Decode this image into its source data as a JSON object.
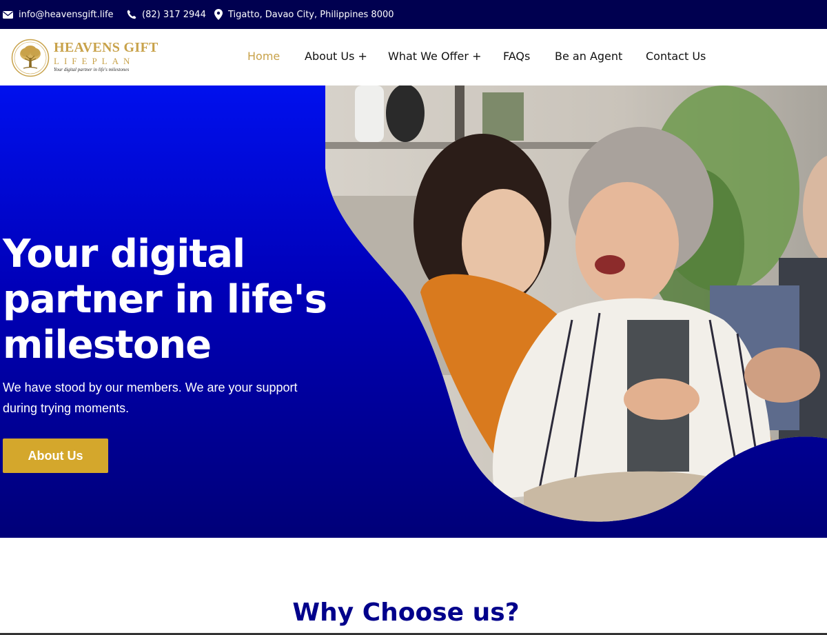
{
  "colors": {
    "topbar_bg": "#000050",
    "accent_gold": "#c8a24a",
    "button_gold": "#d4a72c",
    "hero_blue": "#0000b8",
    "heading_blue": "#00008b"
  },
  "topbar": {
    "email": {
      "icon": "envelope-icon",
      "text": "info@heavensgift.life"
    },
    "phone": {
      "icon": "phone-icon",
      "text": "(82) 317 2944"
    },
    "address": {
      "icon": "map-pin-icon",
      "text": "Tigatto, Davao City, Philippines 8000"
    }
  },
  "logo": {
    "title": "HEAVENS GIFT",
    "subtitle": "LIFEPLAN",
    "tagline": "Your digital partner in life's milestones"
  },
  "nav": {
    "items": [
      {
        "label": "Home",
        "active": true
      },
      {
        "label": "About Us +"
      },
      {
        "label": "What We Offer +"
      },
      {
        "label": "FAQs"
      },
      {
        "label": "Be an Agent"
      },
      {
        "label": "Contact Us"
      }
    ]
  },
  "hero": {
    "title": "Your digital partner in life's milestone",
    "text": "We have stood by our members. We are your support during trying moments.",
    "button_label": "About Us"
  },
  "why": {
    "title": "Why Choose us?"
  }
}
